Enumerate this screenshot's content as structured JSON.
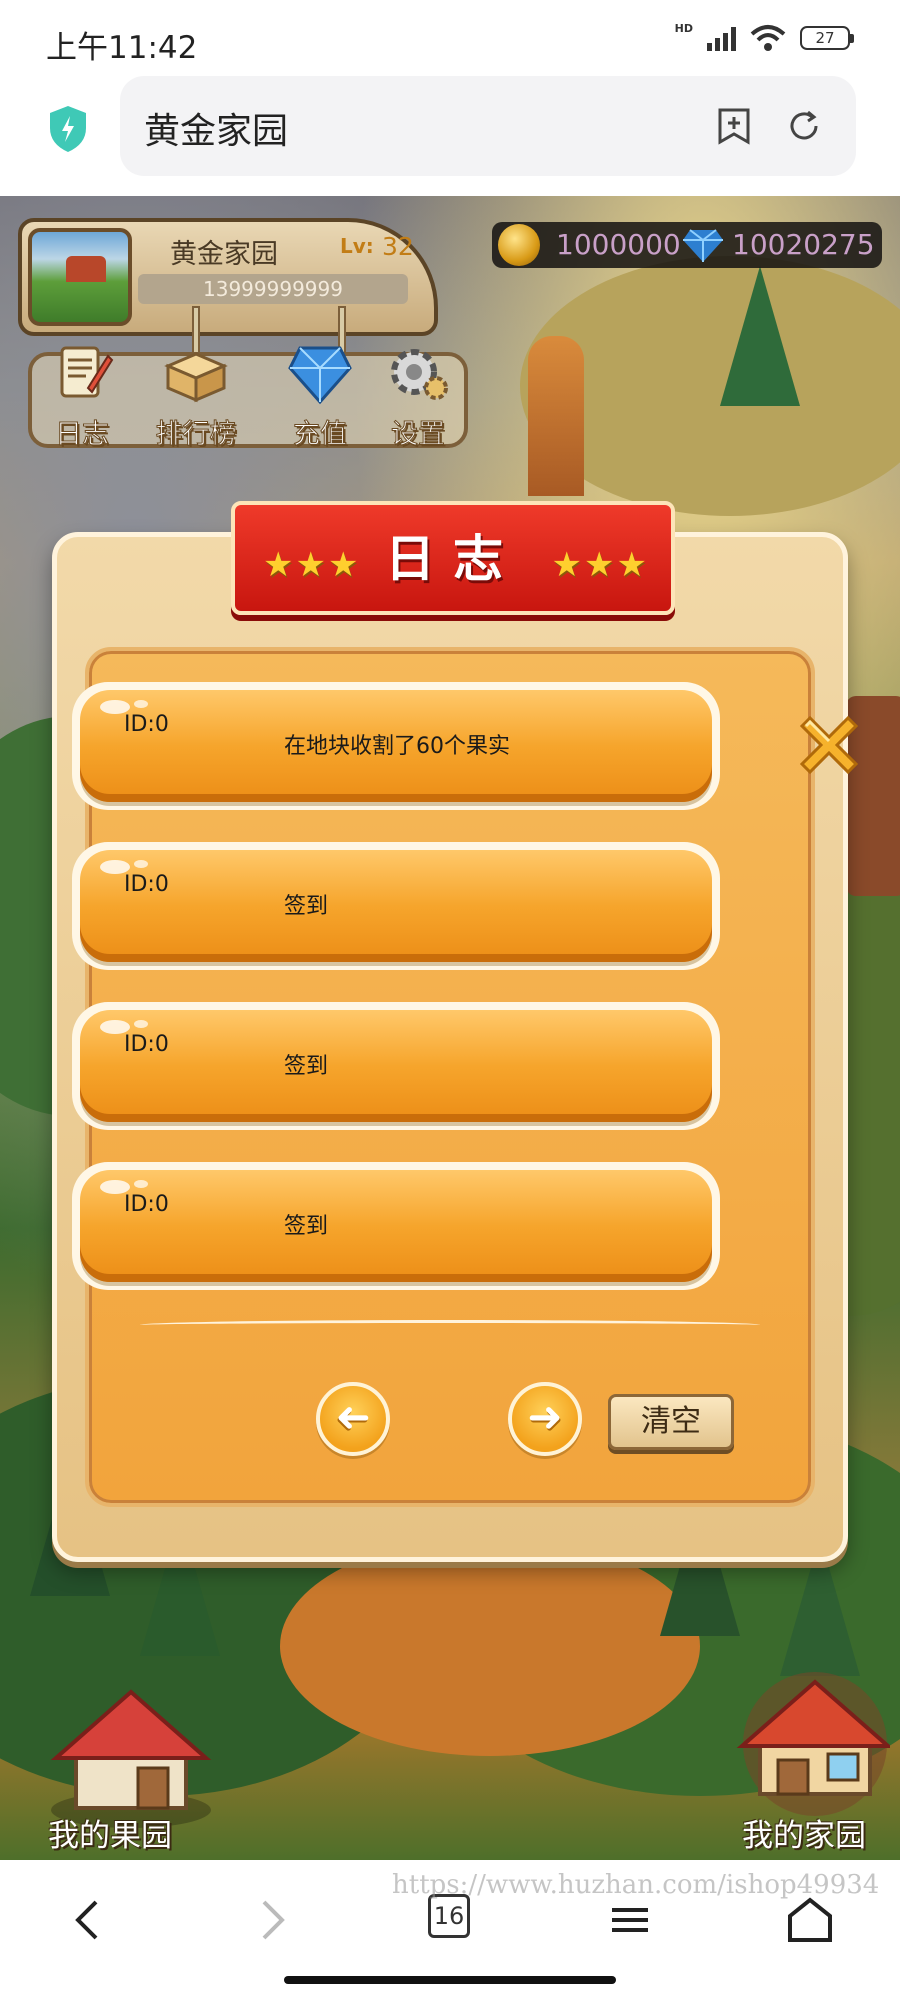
{
  "status_bar": {
    "time": "上午11:42",
    "network": "HD",
    "battery": "27"
  },
  "browser": {
    "address_text": "黄金家园",
    "tab_count": "16"
  },
  "player": {
    "name": "黄金家园",
    "level_label": "Lv:",
    "level": "32",
    "account": "13999999999"
  },
  "currency": {
    "gold": "1000000",
    "diamonds": "10020275"
  },
  "menu": {
    "items": [
      {
        "label": "日志",
        "icon": "scroll-pen-icon"
      },
      {
        "label": "排行榜",
        "icon": "ranking-box-icon"
      },
      {
        "label": "充值",
        "icon": "crystal-icon"
      },
      {
        "label": "设置",
        "icon": "gear-icon"
      }
    ]
  },
  "dialog": {
    "title": "日志",
    "stars_left": "★★★",
    "stars_right": "★★★",
    "entries": [
      {
        "id": "ID:0",
        "text": "在地块收割了60个果实"
      },
      {
        "id": "ID:0",
        "text": "签到"
      },
      {
        "id": "ID:0",
        "text": "签到"
      },
      {
        "id": "ID:0",
        "text": "签到"
      }
    ],
    "prev_arrow": "➜",
    "next_arrow": "➜",
    "clear_label": "清空"
  },
  "bottom": {
    "left_label": "我的果园",
    "right_label": "我的家园"
  },
  "watermark": "https://www.huzhan.com/ishop49934",
  "colors": {
    "banner_red": "#d81e14",
    "button_orange": "#f6a52c",
    "panel_tan": "#eccd94"
  }
}
